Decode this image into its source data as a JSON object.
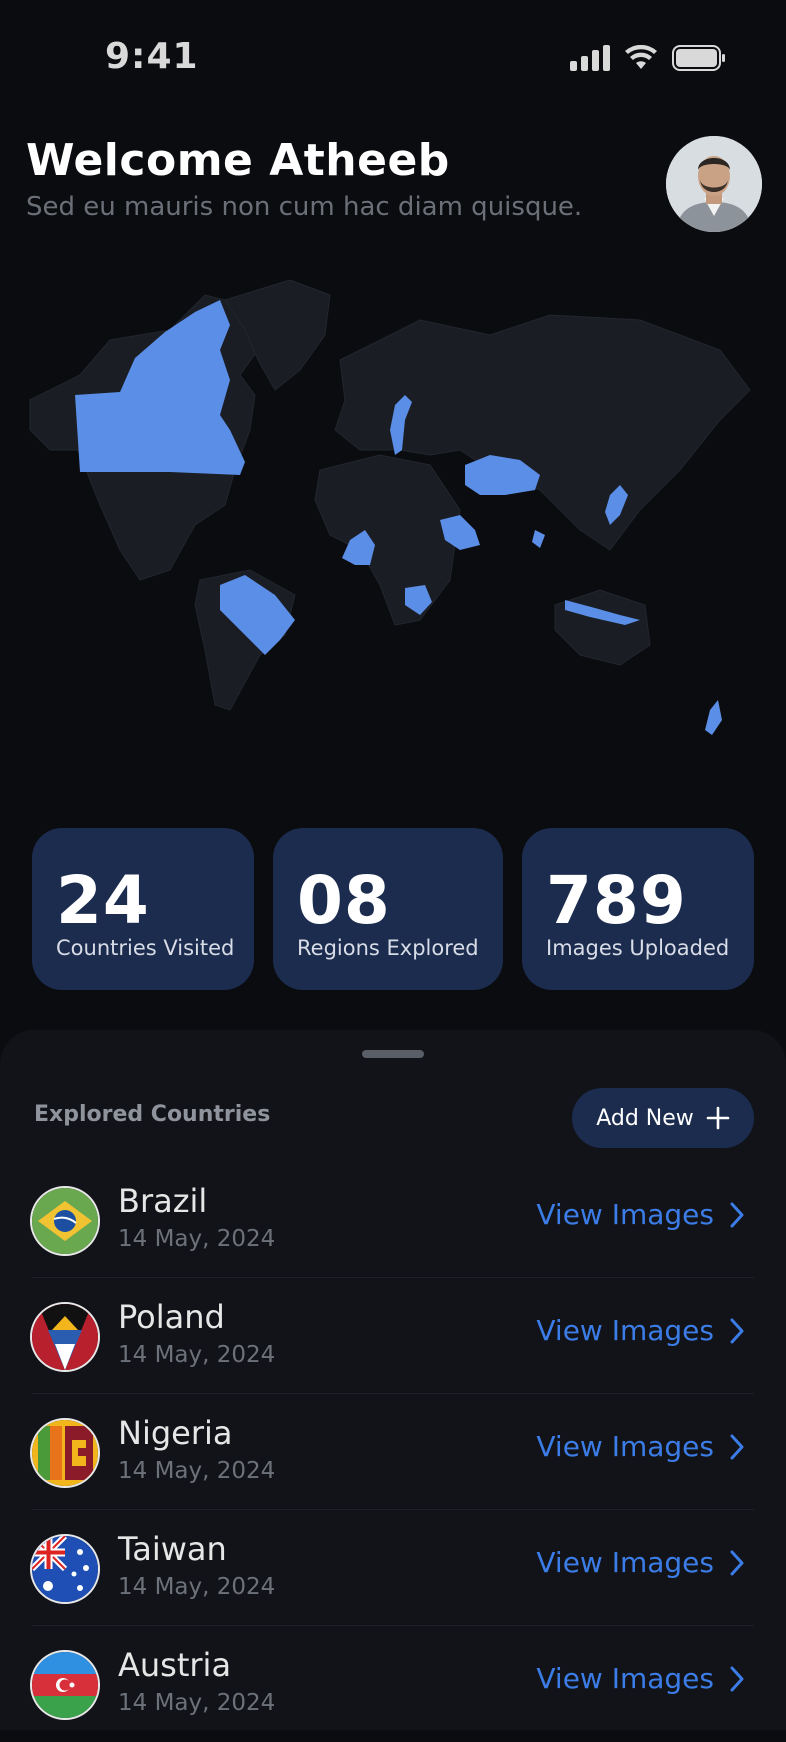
{
  "status": {
    "time": "9:41",
    "icons": [
      "signal-icon",
      "wifi-icon",
      "battery-icon"
    ]
  },
  "header": {
    "title": "Welcome Atheeb",
    "subtitle": "Sed eu mauris non cum hac diam quisque."
  },
  "colors": {
    "accent": "#3b7ce6",
    "card": "#1c2c4e",
    "visited": "#5b8ee6",
    "land": "#1a1d24",
    "background": "#0b0c0f"
  },
  "stats": [
    {
      "value": "24",
      "label": "Countries Visited"
    },
    {
      "value": "08",
      "label": "Regions Explored"
    },
    {
      "value": "789",
      "label": "Images Uploaded"
    }
  ],
  "list": {
    "title": "Explored Countries",
    "add_label": "Add New",
    "view_label": "View Images",
    "countries": [
      {
        "name": "Brazil",
        "date": "14 May, 2024",
        "flag": "brazil-flag-icon"
      },
      {
        "name": "Poland",
        "date": "14 May, 2024",
        "flag": "antigua-flag-icon"
      },
      {
        "name": "Nigeria",
        "date": "14 May, 2024",
        "flag": "sri-lanka-flag-icon"
      },
      {
        "name": "Taiwan",
        "date": "14 May, 2024",
        "flag": "australia-flag-icon"
      },
      {
        "name": "Austria",
        "date": "14 May, 2024",
        "flag": "azerbaijan-flag-icon"
      }
    ]
  }
}
